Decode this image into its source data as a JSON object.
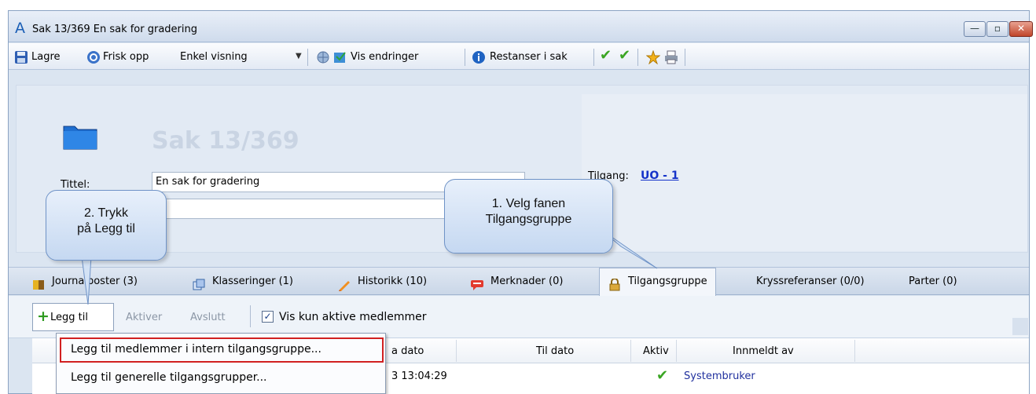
{
  "window": {
    "title": "Sak 13/369 En sak for gradering",
    "app_icon": "A"
  },
  "toolbar": {
    "save_label": "Lagre",
    "refresh_label": "Frisk opp",
    "view_select_value": "Enkel visning",
    "show_changes_label": "Vis endringer",
    "outstanding_label": "Restanser i sak"
  },
  "header": {
    "case_title": "Sak 13/369",
    "tittel_label": "Tittel:",
    "tittel_value": "En sak for gradering",
    "tilgang_label": "Tilgang:",
    "tilgang_value": "UO - 1"
  },
  "tabs": [
    {
      "label": "Journalposter (3)",
      "icon": "journal-icon"
    },
    {
      "label": "Klasseringer (1)",
      "icon": "classification-icon"
    },
    {
      "label": "Historikk (10)",
      "icon": "history-icon"
    },
    {
      "label": "Merknader (0)",
      "icon": "comment-icon"
    },
    {
      "label": "Tilgangsgruppe",
      "icon": "lock-icon",
      "active": true
    },
    {
      "label": "Kryssreferanser (0/0)",
      "icon": ""
    },
    {
      "label": "Parter (0)",
      "icon": ""
    }
  ],
  "subtoolbar": {
    "add_label": "Legg til",
    "activate_label": "Aktiver",
    "end_label": "Avslutt",
    "show_active_label": "Vis kun aktive medlemmer",
    "show_active_checked": true
  },
  "grid": {
    "columns": [
      "a dato",
      "Til dato",
      "Aktiv",
      "Innmeldt av"
    ],
    "rows": [
      {
        "from_date": "3 13:04:29",
        "to_date": "",
        "active": true,
        "registered_by": "Systembruker"
      }
    ]
  },
  "add_menu": {
    "items": [
      "Legg til medlemmer i intern tilgangsgruppe...",
      "Legg til generelle tilgangsgrupper..."
    ]
  },
  "callouts": {
    "step1": [
      "1. Velg fanen",
      "Tilgangsgruppe"
    ],
    "step2": [
      "2. Trykk",
      "på Legg til"
    ]
  },
  "colors": {
    "accent_link": "#1533c9",
    "highlight_border": "#d12020",
    "check_green": "#3aa523"
  }
}
